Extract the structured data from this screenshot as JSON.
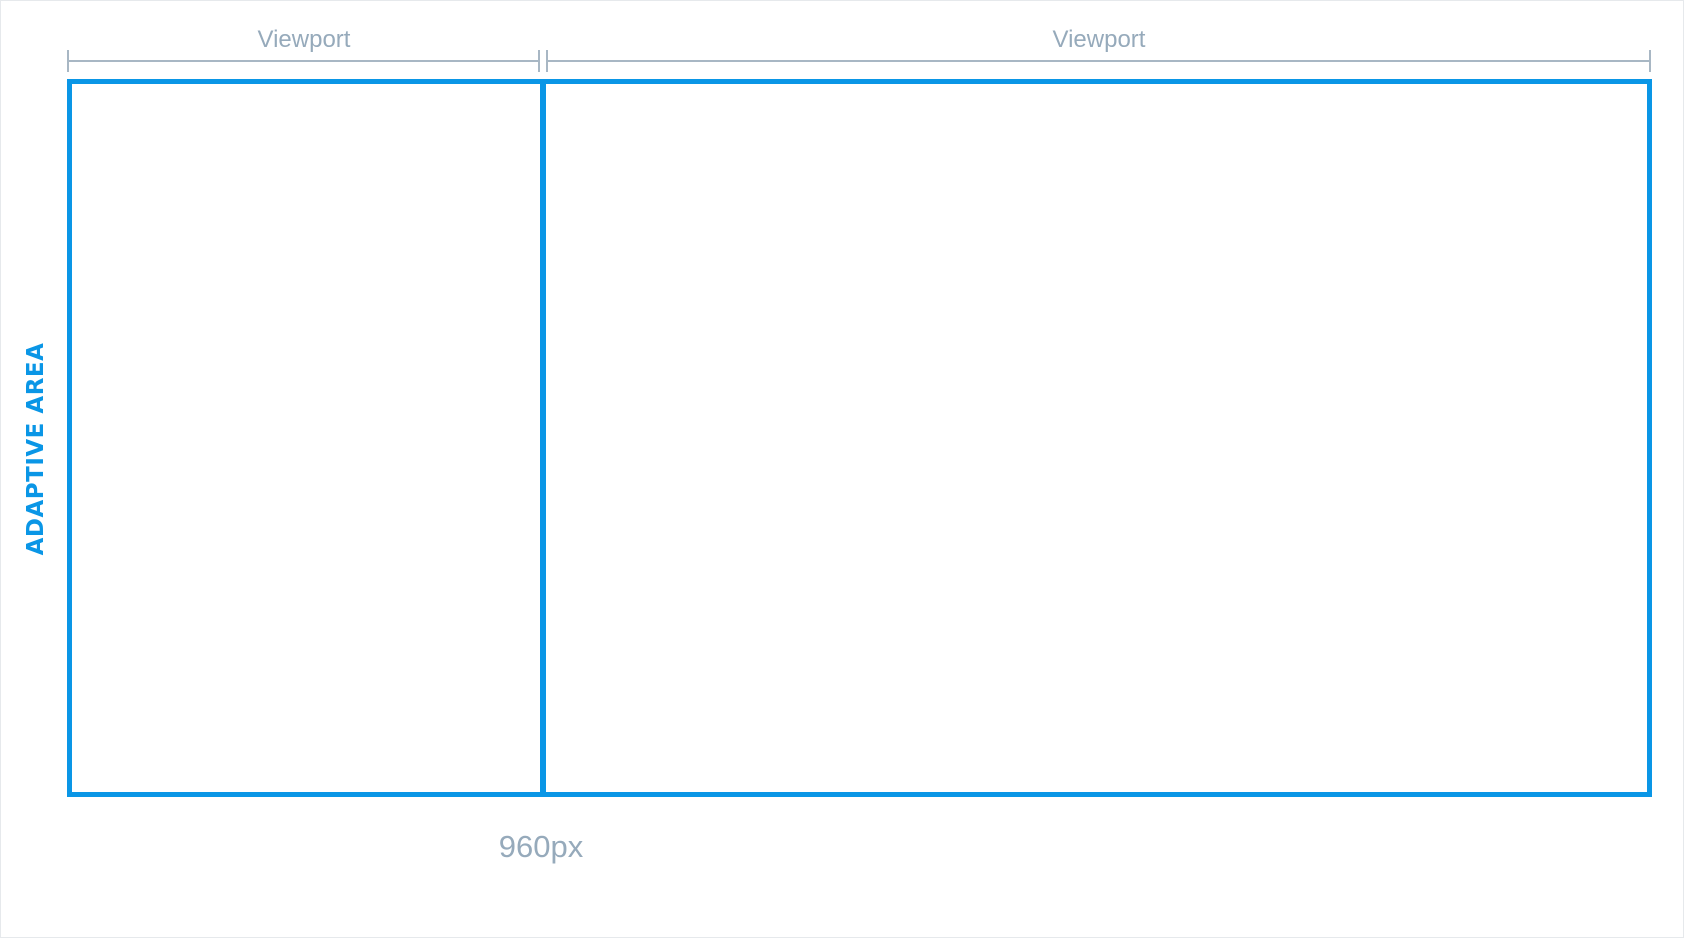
{
  "diagram": {
    "left_dimension_label": "Viewport",
    "right_dimension_label": "Viewport",
    "side_label": "ADAPTIVE AREA",
    "bottom_label": "960px"
  },
  "colors": {
    "accent_blue": "#0a96e6",
    "dimension_gray": "#96aabb",
    "dimension_line": "#a8b7c4",
    "background": "#ffffff"
  }
}
